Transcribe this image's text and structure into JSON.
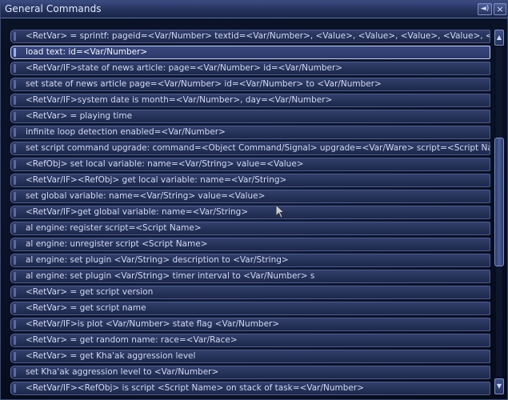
{
  "window": {
    "title": "General Commands"
  },
  "titlebar_icons": {
    "sound": "speaker-icon",
    "close": "close-icon"
  },
  "commands": [
    "<RetVar> = sprintf: pageid=<Var/Number> textid=<Var/Number>, <Value>, <Value>, <Value>, <Value>, <Value>",
    "load text: id=<Var/Number>",
    "<RetVar/IF>state of news article: page=<Var/Number> id=<Var/Number>",
    "set state of news article page=<Var/Number> id=<Var/Number> to <Var/Number>",
    "<RetVar/IF>system date is month=<Var/Number>, day=<Var/Number>",
    "<RetVar> = playing time",
    "infinite loop detection enabled=<Var/Number>",
    "set script command upgrade: command=<Object Command/Signal>  upgrade=<Var/Ware>  script=<Script Name>",
    "<RefObj> set local variable: name=<Var/String> value=<Value>",
    "<RetVar/IF><RefObj> get local variable: name=<Var/String>",
    "set global variable: name=<Var/String> value=<Value>",
    "<RetVar/IF>get global variable: name=<Var/String>",
    "al engine: register script=<Script Name>",
    "al engine: unregister script <Script Name>",
    "al engine: set plugin <Var/String> description to <Var/String>",
    "al engine: set plugin <Var/String> timer interval to <Var/Number> s",
    "<RetVar> = get script version",
    "<RetVar> = get script name",
    "<RetVar/IF>is plot <Var/Number> state flag <Var/Number>",
    "<RetVar> = get random name: race=<Var/Race>",
    "<RetVar> = get Kha'ak aggression level",
    "set Kha'ak aggression level to <Var/Number>",
    "<RetVar/IF><RefObj> is script <Script Name> on stack of task=<Var/Number>"
  ],
  "selected_index": 1,
  "scrollbar": {
    "position": 0.45,
    "visible_fraction": 0.39
  }
}
